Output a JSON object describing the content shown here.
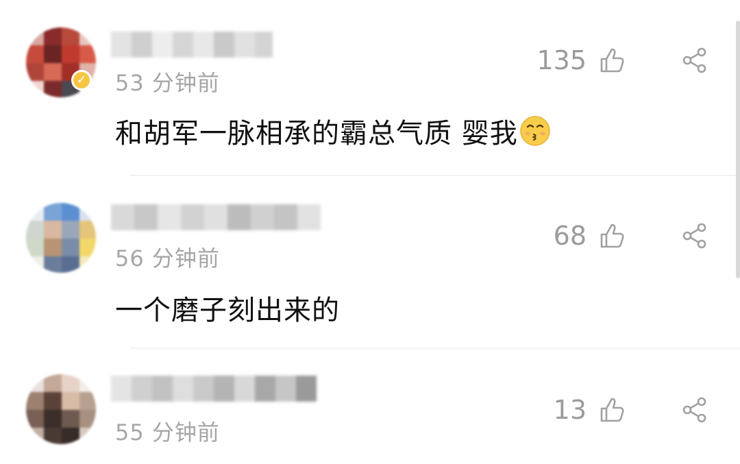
{
  "comments": [
    {
      "time": "53 分钟前",
      "text": "和胡军一脉相承的霸总气质 婴我",
      "likes": "135",
      "emoji": "kissing-face-icon",
      "verified": true
    },
    {
      "time": "56 分钟前",
      "text": "一个磨子刻出来的",
      "likes": "68",
      "verified": false
    },
    {
      "time": "55 分钟前",
      "text": "",
      "likes": "13",
      "verified": false
    }
  ],
  "icons": {
    "like": "thumbs-up-outline-icon",
    "share": "share-icon"
  },
  "colors": {
    "time": "#a6a6a6",
    "text": "#111111",
    "likes": "#9b9b9b",
    "verified_badge": "#f5c542"
  }
}
